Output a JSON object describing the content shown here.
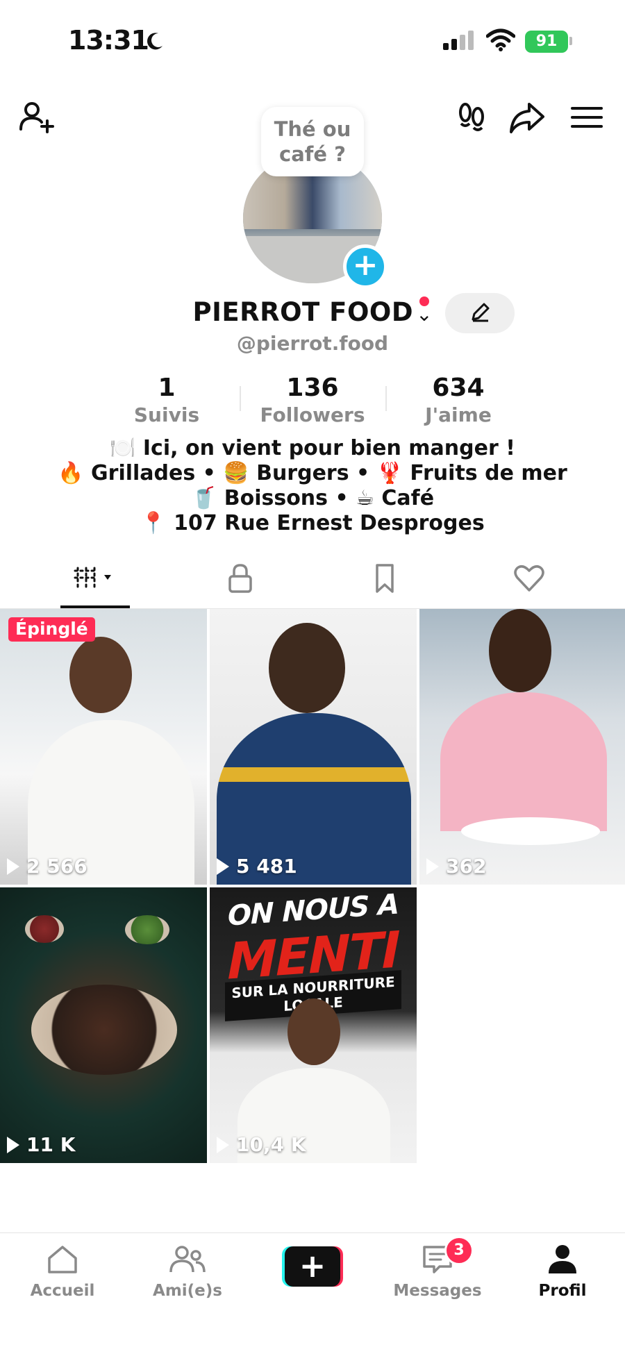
{
  "status_bar": {
    "time": "13:31",
    "battery": "91"
  },
  "header": {
    "bubble_text": "Thé ou café ?"
  },
  "profile": {
    "display_name": "PIERROT FOOD",
    "username": "@pierrot.food",
    "stats": [
      {
        "value": "1",
        "label": "Suivis"
      },
      {
        "value": "136",
        "label": "Followers"
      },
      {
        "value": "634",
        "label": "J'aime"
      }
    ],
    "bio": [
      "🍽️ Ici, on vient pour bien manger !",
      "🔥 Grillades • 🍔 Burgers • 🦞 Fruits de mer",
      "🥤 Boissons • ☕ Café",
      "📍 107 Rue Ernest Desproges"
    ]
  },
  "tabs": [
    {
      "name": "videos-grid-icon"
    },
    {
      "name": "lock-icon"
    },
    {
      "name": "bookmark-icon"
    },
    {
      "name": "heart-icon"
    }
  ],
  "videos": [
    {
      "views": "2 566",
      "badge": "Épinglé"
    },
    {
      "views": "5 481"
    },
    {
      "views": "362"
    },
    {
      "views": "11 K"
    },
    {
      "views": "10,4 K",
      "overlay": {
        "line1": "ON NOUS A",
        "line2": "MENTI",
        "line3": "SUR LA NOURRITURE LOCALE"
      }
    }
  ],
  "bottom_nav": {
    "home": "Accueil",
    "friends": "Ami(e)s",
    "messages": "Messages",
    "messages_badge": "3",
    "profile": "Profil"
  },
  "colors": {
    "accent": "#fe2c55",
    "cyan": "#25f4ee",
    "battery": "#31c75a",
    "avatar_add": "#20b6e8"
  }
}
